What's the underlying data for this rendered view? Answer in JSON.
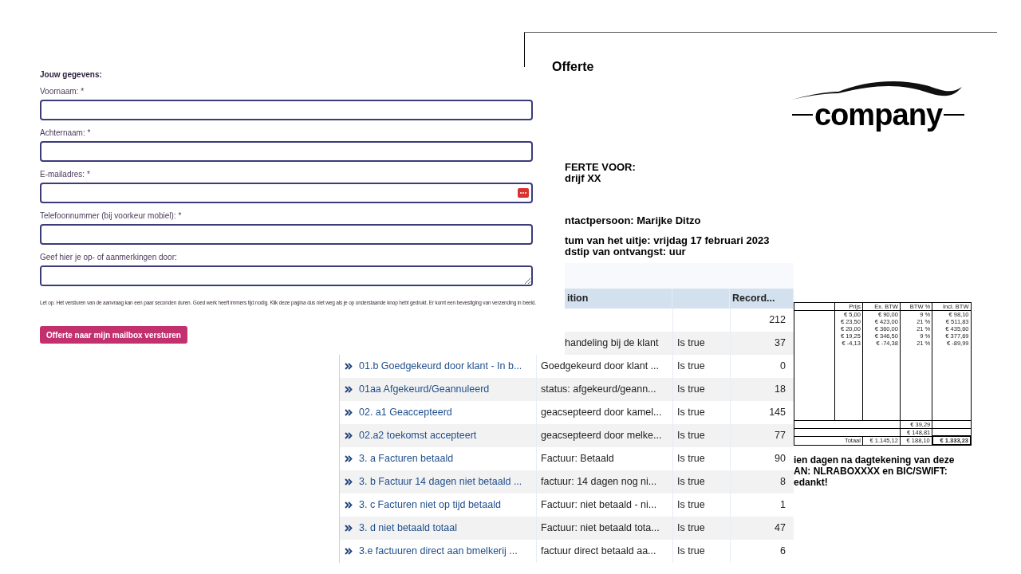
{
  "form": {
    "heading": "Jouw gegevens:",
    "fields": [
      {
        "label": "Voornaam: *",
        "kind": "input"
      },
      {
        "label": "Achternaam: *",
        "kind": "input"
      },
      {
        "label": "E-mailadres: *",
        "kind": "icon_input"
      },
      {
        "label": "Telefoonnummer (bij voorkeur mobiel): *",
        "kind": "input"
      },
      {
        "label": "Geef hier je op- of aanmerkingen door:",
        "kind": "textarea"
      }
    ],
    "note": "Let op. Het versturen van de aanvraag kan een paar seconden duren. Goed werk heeft immers tijd nodig. Klik deze pagina dus niet weg als je op onderstaande knop hebt gedrukt. Er komt een bevestiging van verzending in beeld.",
    "submit": "Offerte naar mijn mailbox versturen"
  },
  "document": {
    "title": "Offerte",
    "logo_text": "company",
    "line_groups": [
      [
        "FERTE VOOR:",
        "drijf XX"
      ],
      [
        "ntactpersoon: Marijke Ditzo"
      ],
      [
        "tum van het uitje: vrijdag 17 februari 2023",
        "dstip van ontvangst: uur"
      ]
    ],
    "price_table": {
      "columns": [
        "Prijs",
        "Ex. BTW",
        "BTW %",
        "Incl. BTW"
      ],
      "rows": [
        [
          "€ 5,00",
          "€ 90,00",
          "9 %",
          "€ 98,10"
        ],
        [
          "€ 23,50",
          "€ 423,00",
          "21 %",
          "€ 511,83"
        ],
        [
          "€ 20,00",
          "€ 360,00",
          "21 %",
          "€ 435,60"
        ],
        [
          "€ 19,25",
          "€ 346,50",
          "9 %",
          "€ 377,69"
        ],
        [
          "€ -4,13",
          "€ -74,38",
          "21 %",
          "€ -89,99"
        ]
      ],
      "btw_lines": [
        "€ 39,29",
        "€ 148,81"
      ],
      "total": {
        "label": "Totaal",
        "ex": "€ 1.145,12",
        "btw": "€ 188,10",
        "incl": "€ 1.333,23"
      }
    },
    "footer_lines": [
      "ien dagen na dagtekening van deze",
      "AN: NLRABOXXXX en BIC/SWIFT:",
      "edankt!"
    ]
  },
  "table": {
    "columns": [
      "ition",
      "",
      "Record..."
    ],
    "rows": [
      {
        "count": "212"
      },
      {
        "condition": "handeling bij de klant",
        "operator": "Is true",
        "count": "37"
      },
      {
        "name": "01.b Goedgekeurd door klant - In b...",
        "condition": "Goedgekeurd door klant ...",
        "operator": "Is true",
        "count": "0"
      },
      {
        "name": "01aa Afgekeurd/Geannuleerd",
        "condition": "status: afgekeurd/geann...",
        "operator": "Is true",
        "count": "18"
      },
      {
        "name": "02. a1 Geaccepteerd",
        "condition": "geacsepteerd door kamel...",
        "operator": "Is true",
        "count": "145"
      },
      {
        "name": "02.a2 toekomst accepteert",
        "condition": "geacsepteerd door melke...",
        "operator": "Is true",
        "count": "77"
      },
      {
        "name": "3. a Facturen betaald",
        "condition": "Factuur: Betaald",
        "operator": "Is true",
        "count": "90"
      },
      {
        "name": "3. b Factuur 14 dagen niet betaald ...",
        "condition": "factuur: 14 dagen nog ni...",
        "operator": "Is true",
        "count": "8"
      },
      {
        "name": "3. c Facturen niet op tijd betaald",
        "condition": "Factuur: niet betaald - ni...",
        "operator": "Is true",
        "count": "1"
      },
      {
        "name": "3. d niet betaald totaal",
        "condition": "Factuur: niet betaald tota...",
        "operator": "Is true",
        "count": "47"
      },
      {
        "name": "3.e factuuren direct aan bmelkerij ...",
        "condition": "factuur direct betaald aa...",
        "operator": "Is true",
        "count": "6"
      }
    ]
  }
}
